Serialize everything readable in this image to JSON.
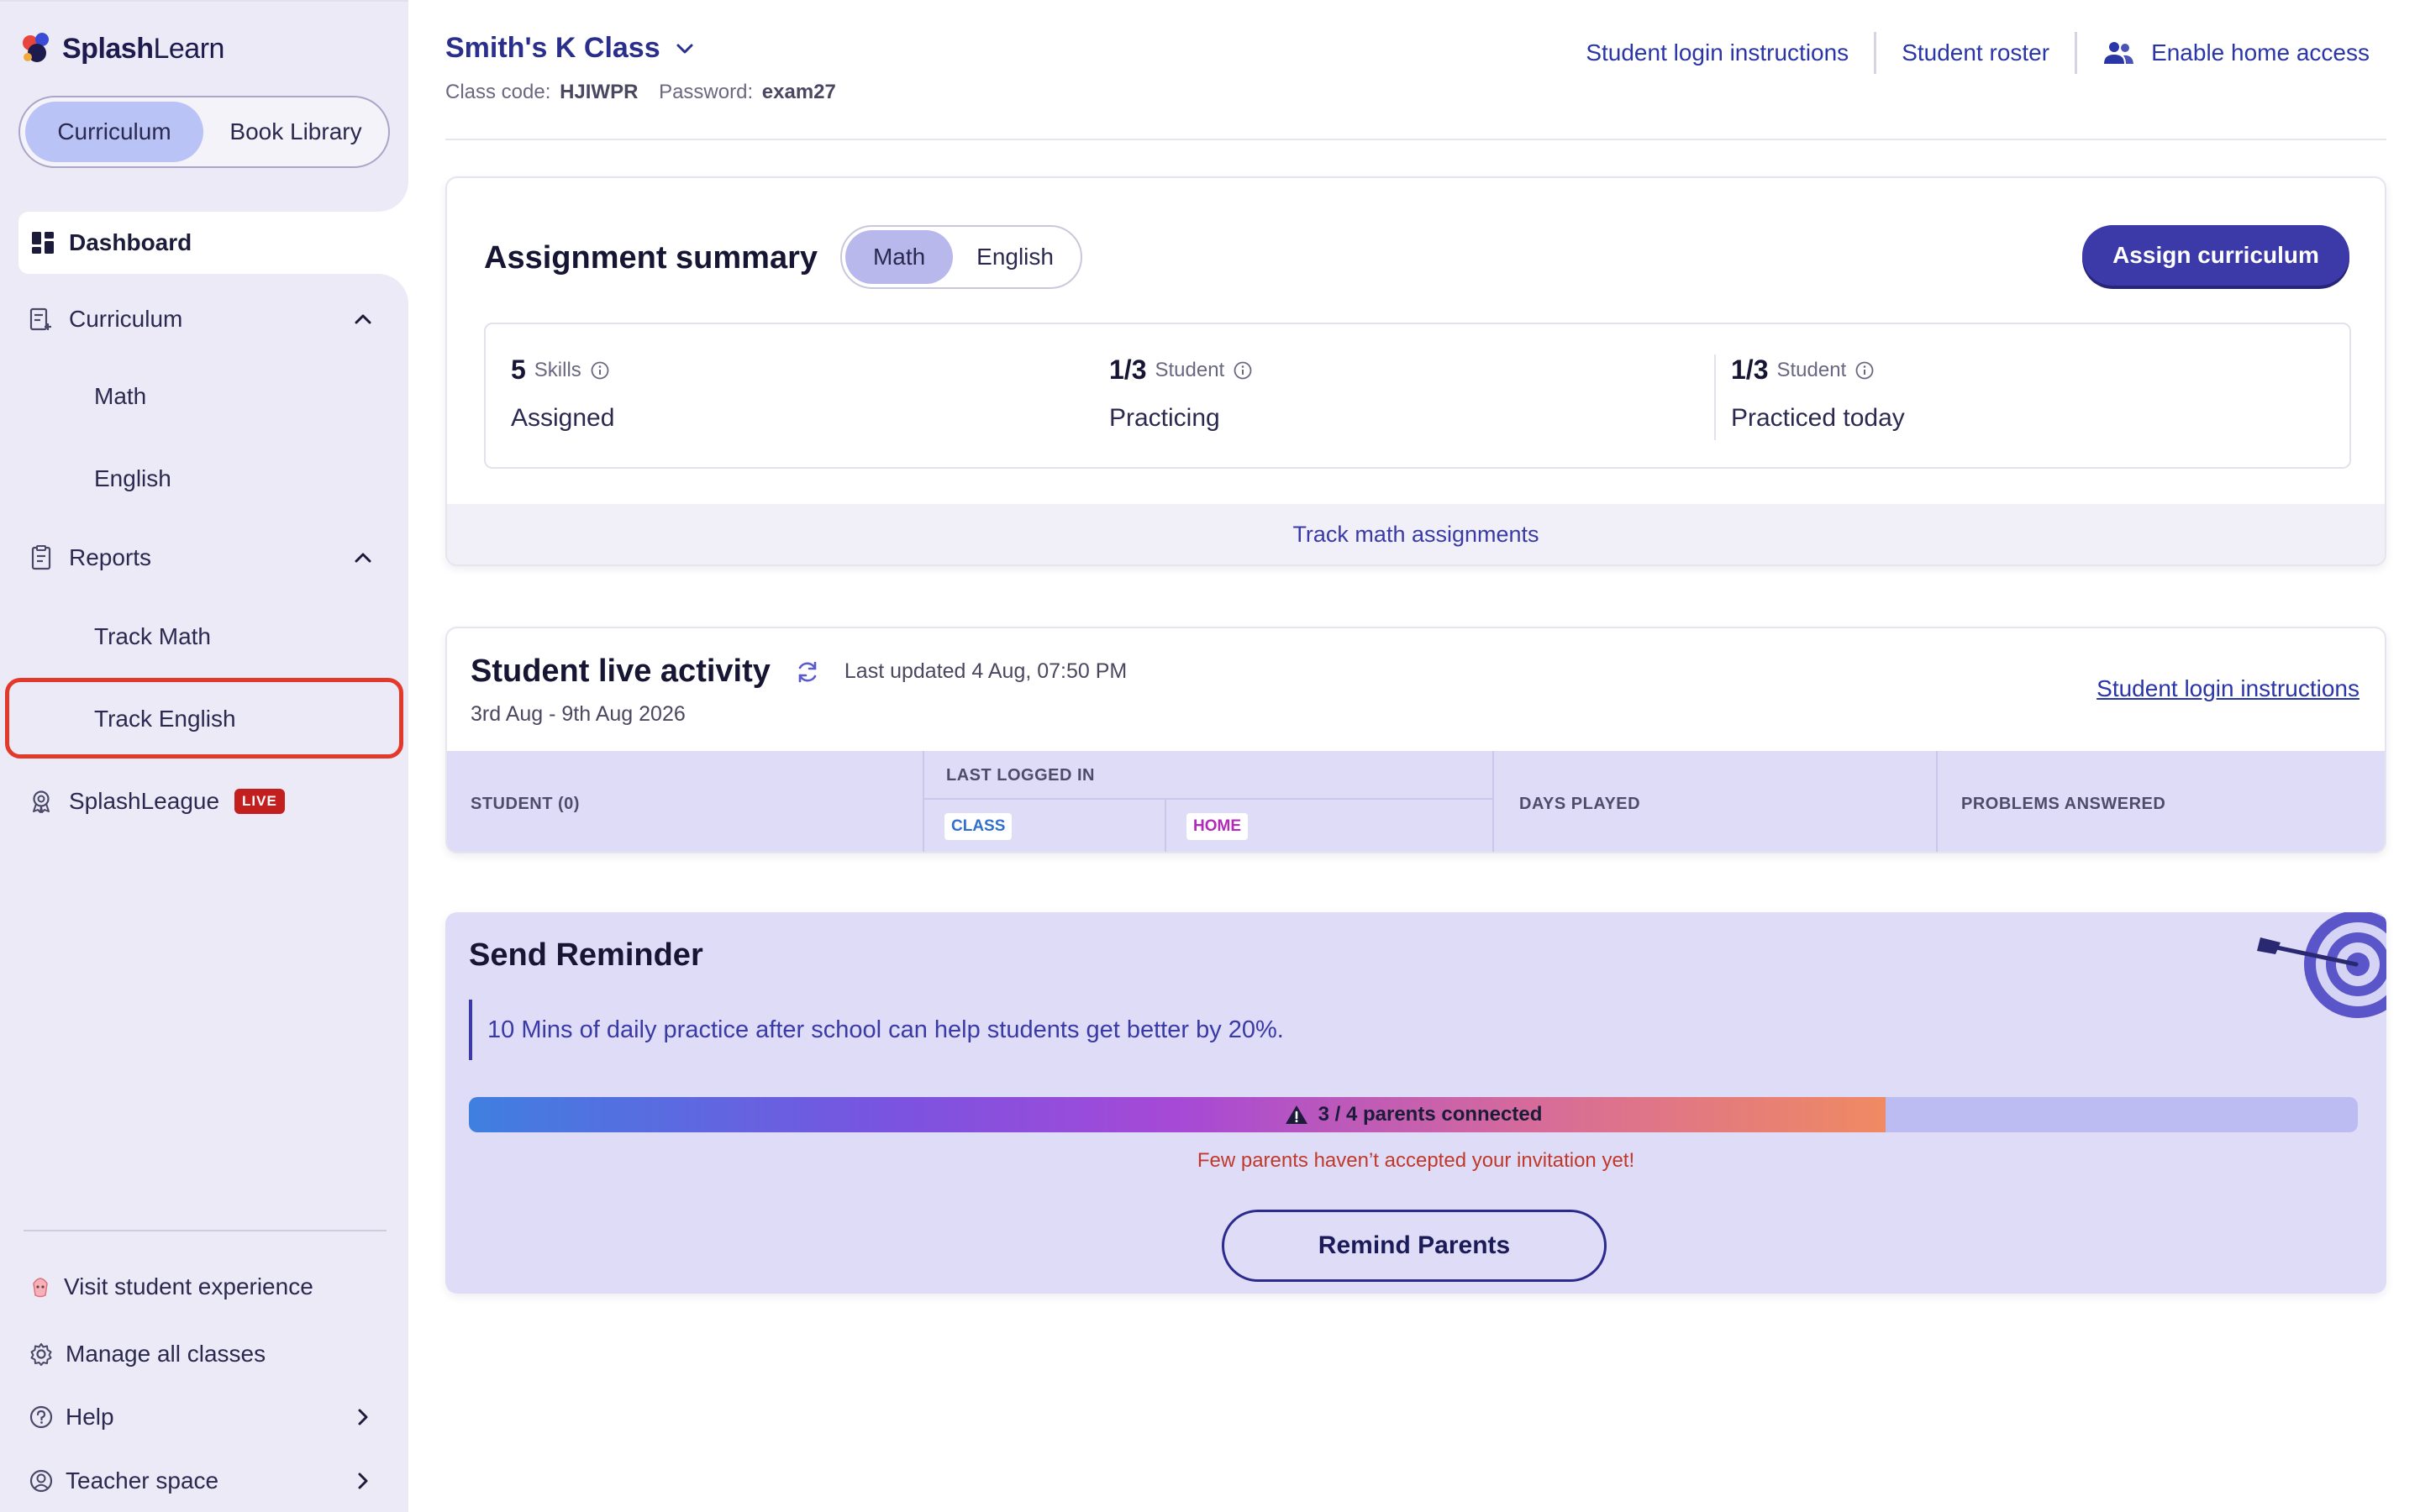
{
  "brand": {
    "name_bold": "Splash",
    "name_light": "Learn"
  },
  "top_toggle": {
    "active": "Curriculum",
    "other": "Book Library"
  },
  "sidebar": {
    "dashboard": "Dashboard",
    "curriculum": {
      "label": "Curriculum",
      "children": [
        "Math",
        "English"
      ]
    },
    "reports": {
      "label": "Reports",
      "children": [
        "Track Math",
        "Track English"
      ]
    },
    "league": {
      "label": "SplashLeague",
      "badge": "LIVE"
    },
    "footer": [
      "Visit student experience",
      "Manage all classes",
      "Help",
      "Teacher space"
    ]
  },
  "header": {
    "class_name": "Smith's K Class",
    "class_code_label": "Class code:",
    "class_code": "HJIWPR",
    "password_label": "Password:",
    "password": "exam27",
    "links": [
      "Student login instructions",
      "Student roster",
      "Enable home access"
    ]
  },
  "assignment": {
    "title": "Assignment summary",
    "subjects": [
      "Math",
      "English"
    ],
    "active_subject": "Math",
    "assign_button": "Assign curriculum",
    "stats": [
      {
        "value": "5",
        "unit": "Skills",
        "label": "Assigned"
      },
      {
        "value": "1/3",
        "unit": "Student",
        "label": "Practicing"
      },
      {
        "value": "1/3",
        "unit": "Student",
        "label": "Practiced today"
      }
    ],
    "track_link": "Track math assignments"
  },
  "live": {
    "title": "Student live activity",
    "last_updated": "Last updated 4 Aug, 07:50 PM",
    "range": "3rd Aug - 9th Aug 2026",
    "login_link": "Student login instructions",
    "columns": {
      "student": "STUDENT (0)",
      "last_logged": "LAST LOGGED IN",
      "class_tag": "CLASS",
      "home_tag": "HOME",
      "days": "DAYS PLAYED",
      "problems": "PROBLEMS ANSWERED"
    }
  },
  "reminder": {
    "title": "Send Reminder",
    "quote": "10 Mins of daily practice after school can help students get better by 20%.",
    "progress_text": "3 / 4 parents connected",
    "progress_fraction": 0.75,
    "warning": "Few parents haven’t accepted your invitation yet!",
    "button": "Remind Parents"
  },
  "colors": {
    "accent": "#3c3aa8",
    "link": "#2a35a8",
    "highlight": "#e2392b",
    "live_badge": "#c41f1f"
  }
}
